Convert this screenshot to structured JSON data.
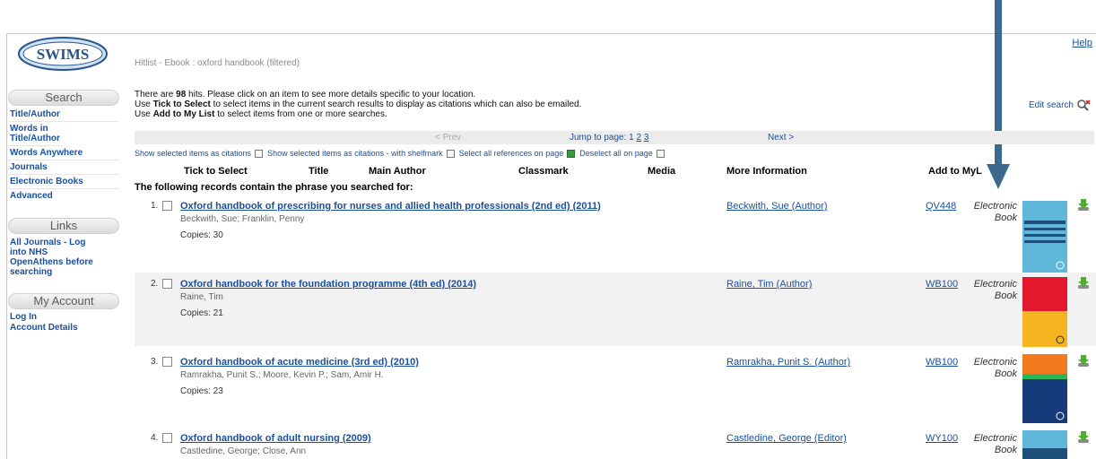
{
  "app": {
    "logo_text": "SWIMS",
    "help_label": "Help"
  },
  "sidebar": {
    "search": {
      "heading": "Search",
      "items": [
        {
          "label": "Title/Author"
        },
        {
          "label": "Words in Title/Author"
        },
        {
          "label": "Words Anywhere"
        },
        {
          "label": "Journals"
        },
        {
          "label": "Electronic Books"
        },
        {
          "label": "Advanced"
        }
      ]
    },
    "links": {
      "heading": "Links",
      "items": [
        {
          "label": "All Journals - Log into NHS OpenAthens before searching"
        }
      ]
    },
    "account": {
      "heading": "My Account",
      "items": [
        {
          "label": "Log In"
        },
        {
          "label": "Account Details"
        }
      ]
    }
  },
  "hitlist": {
    "title": "Hitlist - Ebook : oxford handbook (filtered)",
    "intro_line1_pre": "There are ",
    "hit_count": "98",
    "intro_line1_post": " hits. Please click on an item to see more details specific to your location.",
    "intro_line2_pre": "Use ",
    "intro_line2_bold": "Tick to Select",
    "intro_line2_post": " to select items in the current search results to display as citations which can also be emailed.",
    "intro_line3_pre": "Use ",
    "intro_line3_bold": "Add to My List",
    "intro_line3_post": " to select items from one or more searches.",
    "edit_search_label": "Edit search"
  },
  "pagination": {
    "prev_label": "< Prev",
    "jump_label": "Jump to page:",
    "pages": [
      "1",
      "2",
      "3"
    ],
    "next_label": "Next >"
  },
  "actions": {
    "show_citations": "Show selected items as citations",
    "show_citations_shelfmark": "Show selected items as citations - with shelfmark",
    "select_all": "Select all references on page",
    "deselect_all": "Deselect all on page"
  },
  "columns": {
    "tick": "Tick to Select",
    "title": "Title",
    "author": "Main Author",
    "classmark": "Classmark",
    "media": "Media",
    "more_info": "More Information",
    "add_to_list": "Add to MyL"
  },
  "phrase_note": "The following records contain the phrase you searched for:",
  "records": [
    {
      "num": "1.",
      "title": "Oxford handbook of prescribing for nurses and allied health professionals (2nd ed) (2011)",
      "authors": "Beckwith, Sue; Franklin, Penny",
      "copies": "Copies: 30",
      "more_info": "Beckwith, Sue (Author)",
      "classmark": "QV448",
      "media": "Electronic Book",
      "cover_color": "#5fb8d9"
    },
    {
      "num": "2.",
      "title": "Oxford handbook for the foundation programme (4th ed) (2014)",
      "authors": "Raine, Tim",
      "copies": "Copies: 21",
      "more_info": "Raine, Tim (Author)",
      "classmark": "WB100",
      "media": "Electronic Book",
      "cover_color": "#e3182d"
    },
    {
      "num": "3.",
      "title": "Oxford handbook of acute medicine (3rd ed) (2010)",
      "authors": "Ramrakha, Punit S.; Moore, Kevin P.; Sam, Amir H.",
      "copies": "Copies: 23",
      "more_info": "Ramrakha, Punit S. (Author)",
      "classmark": "WB100",
      "media": "Electronic Book",
      "cover_color": "#f47a20"
    },
    {
      "num": "4.",
      "title": "Oxford handbook of adult nursing (2009)",
      "authors": "Castledine, George; Close, Ann",
      "copies": "",
      "more_info": "Castledine, George (Editor)",
      "classmark": "WY100",
      "media": "Electronic Book",
      "cover_color": "#5fb8d9"
    }
  ],
  "colors": {
    "link": "#1a4f9c",
    "annotation_arrow": "#3b6a8e"
  }
}
